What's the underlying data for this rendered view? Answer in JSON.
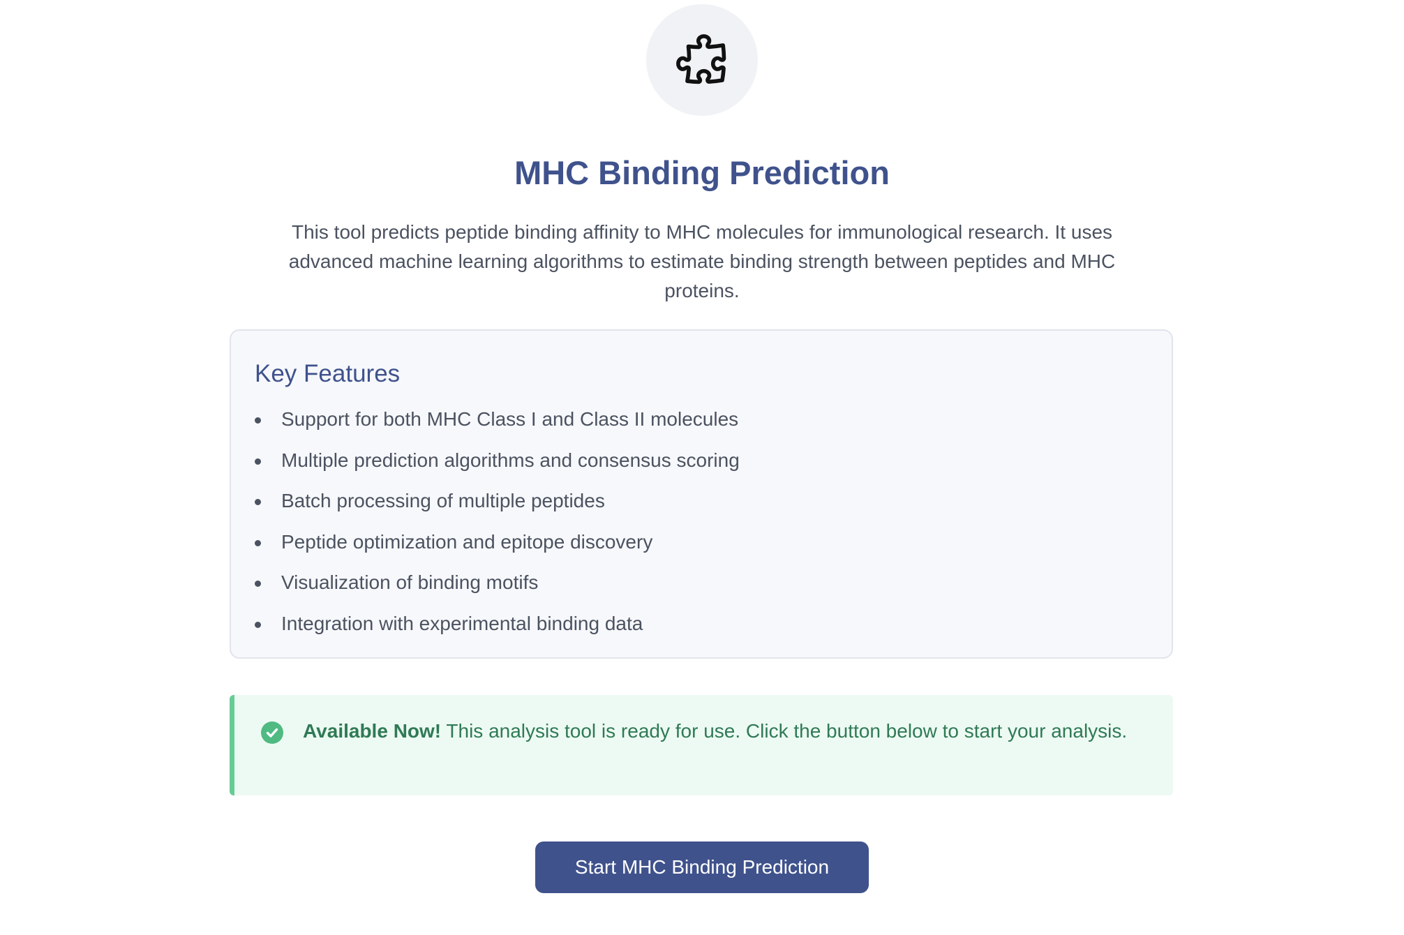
{
  "header": {
    "icon": "puzzle-piece-icon",
    "title": "MHC Binding Prediction",
    "description": "This tool predicts peptide binding affinity to MHC molecules for immunological research. It uses advanced machine learning algorithms to estimate binding strength between peptides and MHC proteins."
  },
  "features": {
    "heading": "Key Features",
    "items": [
      "Support for both MHC Class I and Class II molecules",
      "Multiple prediction algorithms and consensus scoring",
      "Batch processing of multiple peptides",
      "Peptide optimization and epitope discovery",
      "Visualization of binding motifs",
      "Integration with experimental binding data"
    ]
  },
  "notice": {
    "icon": "check-circle-icon",
    "strong": "Available Now!",
    "text": " This analysis tool is ready for use. Click the button below to start your analysis.",
    "color": "#2f7a55",
    "accent": "#66cc95"
  },
  "action": {
    "button_label": "Start MHC Binding Prediction"
  },
  "colors": {
    "brand": "#3f528c",
    "text": "#4b5260",
    "card_bg": "#f7f8fb",
    "notice_bg": "#edfaf3"
  }
}
